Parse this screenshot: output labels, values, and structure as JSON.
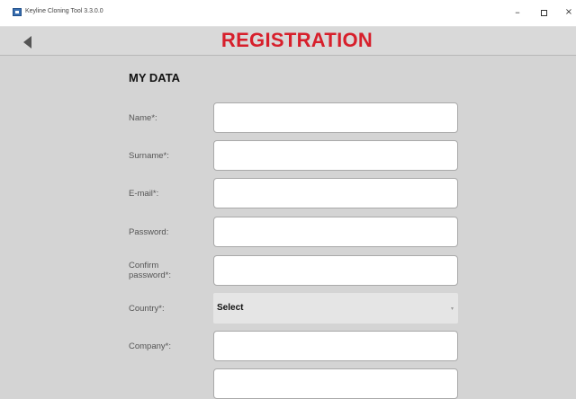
{
  "window": {
    "title": "Keyline Cloning Tool 3.3.0.0",
    "minimize_glyph": "–",
    "close_glyph": "×"
  },
  "header": {
    "title": "REGISTRATION"
  },
  "section": {
    "title": "MY DATA"
  },
  "fields": {
    "name": {
      "label": "Name*:",
      "value": ""
    },
    "surname": {
      "label": "Surname*:",
      "value": ""
    },
    "email": {
      "label": "E-mail*:",
      "value": ""
    },
    "password": {
      "label": "Password:",
      "value": ""
    },
    "confirm_password": {
      "label_line1": "Confirm",
      "label_line2": "password*:",
      "value": ""
    },
    "country": {
      "label": "Country*:",
      "selected": "Select",
      "caret": "▾"
    },
    "company": {
      "label": "Company*:",
      "value": ""
    }
  },
  "colors": {
    "brand_red": "#d71f2b",
    "background": "#d4d4d4"
  }
}
